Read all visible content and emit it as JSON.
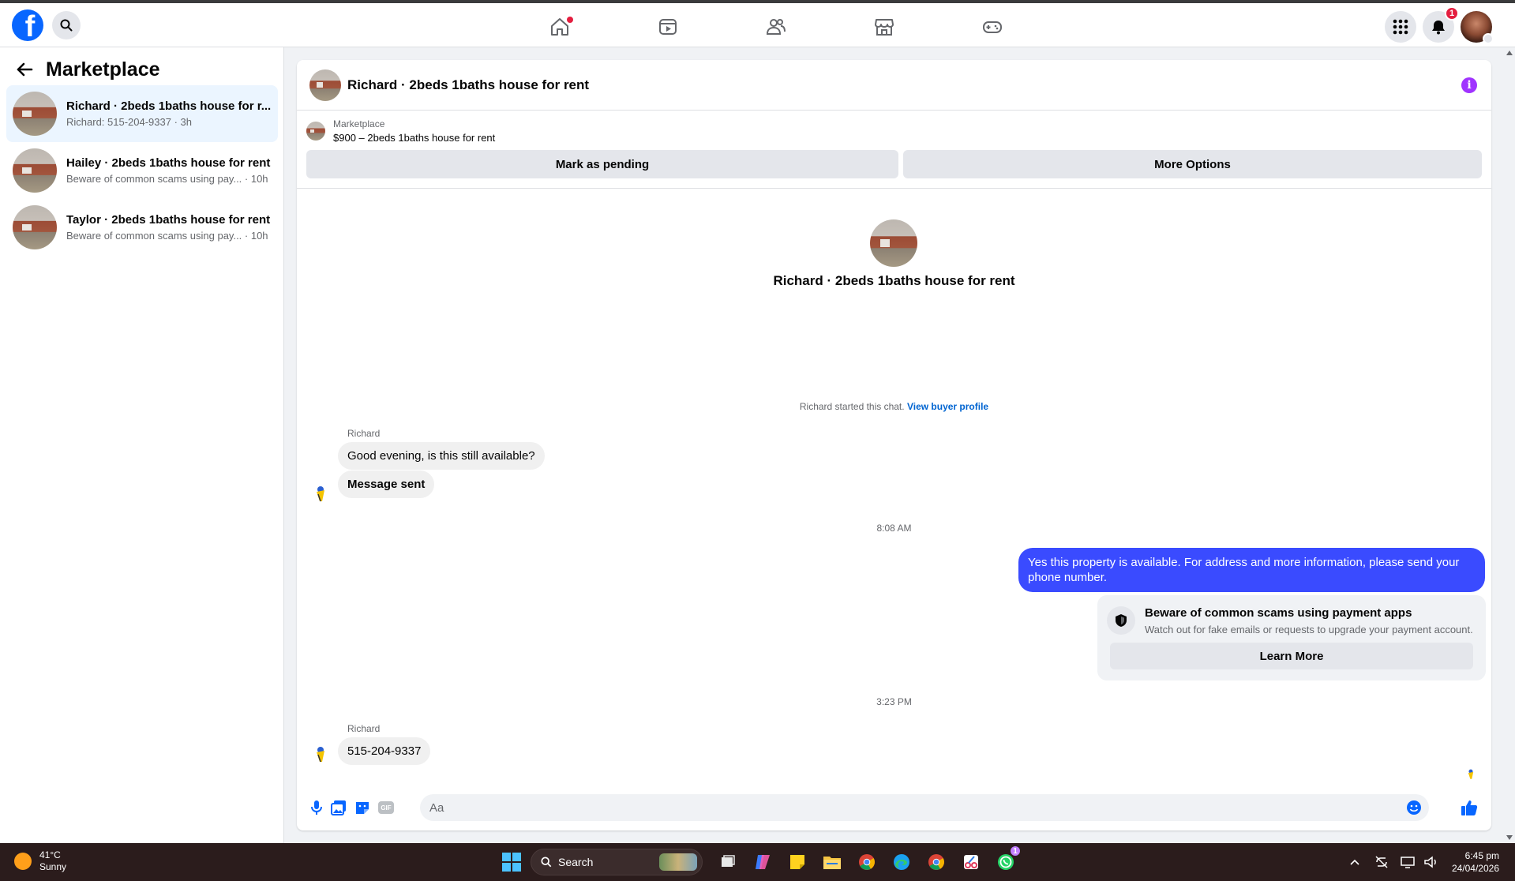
{
  "nav": {
    "notification_count": "1",
    "icons": [
      "home-icon",
      "video-icon",
      "friends-icon",
      "marketplace-icon",
      "gaming-icon"
    ]
  },
  "sidebar": {
    "title": "Marketplace",
    "conversations": [
      {
        "title": "Richard · 2beds 1baths house for r...",
        "subtitle": "Richard: 515-204-9337 · 3h"
      },
      {
        "title": "Hailey · 2beds 1baths house for rent",
        "subtitle": "Beware of common scams using pay... · 10h"
      },
      {
        "title": "Taylor · 2beds 1baths house for rent",
        "subtitle": "Beware of common scams using pay... · 10h"
      }
    ]
  },
  "chat": {
    "header_title": "Richard · 2beds 1baths house for rent",
    "marketplace_label": "Marketplace",
    "listing": "$900 – 2beds 1baths house for rent",
    "mark_pending": "Mark as pending",
    "more_options": "More Options",
    "center_title": "Richard · 2beds 1baths house for rent",
    "started_text": "Richard started this chat.",
    "view_profile": "View buyer profile",
    "messages": [
      {
        "sender": "Richard",
        "text": "Good evening, is this still available?"
      },
      {
        "text": "Message sent"
      },
      {
        "time": "8:08 AM"
      },
      {
        "text": "Yes this property is available. For address and more information, please send your phone number."
      },
      {
        "time": "3:23 PM"
      },
      {
        "sender": "Richard",
        "text": "515-204-9337"
      }
    ],
    "scam_card": {
      "title": "Beware of common scams using payment apps",
      "subtitle": "Watch out for fake emails or requests to upgrade your payment account.",
      "button": "Learn More"
    },
    "composer_placeholder": "Aa",
    "gif_label": "GIF"
  },
  "taskbar": {
    "temp": "41°C",
    "condition": "Sunny",
    "search_label": "Search",
    "time": "6:45 pm",
    "date": "24/04/2026",
    "whatsapp_badge": "1"
  },
  "colors": {
    "brand": "#0866ff",
    "outgoing_bubble": "#3a4bff",
    "info": "#a033ff"
  }
}
